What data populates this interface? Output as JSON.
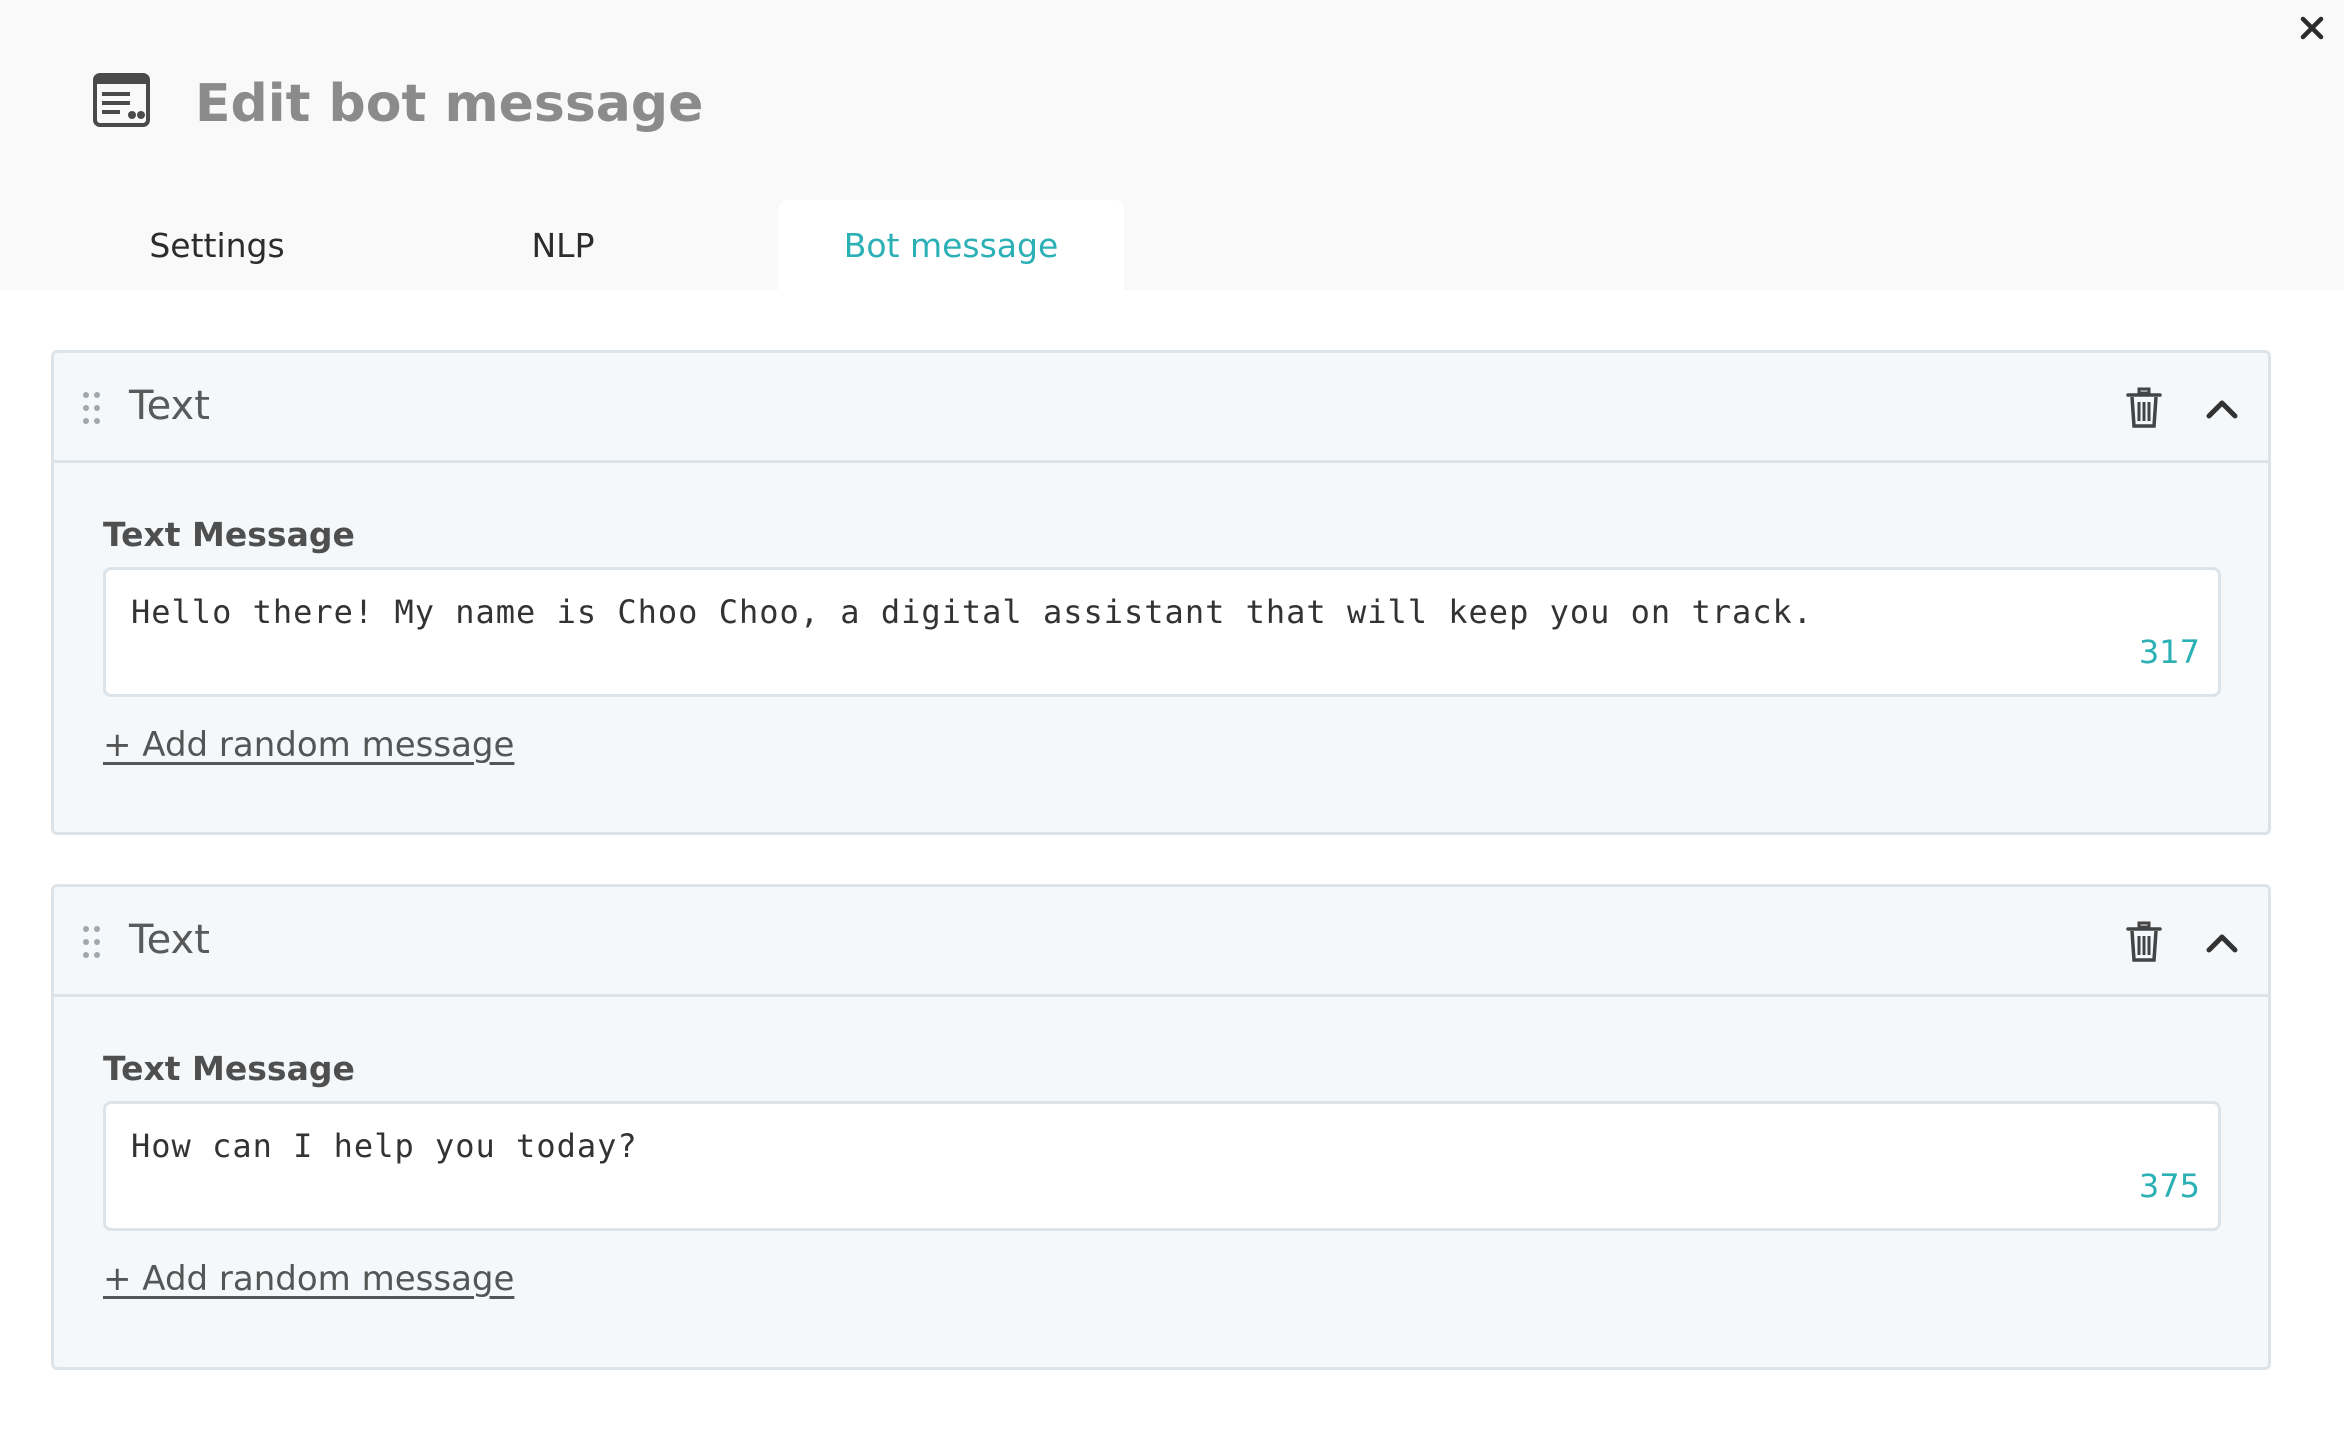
{
  "dialog": {
    "title": "Edit bot message",
    "title_icon": "message-template-icon",
    "close_icon": "close-icon"
  },
  "tabs": [
    {
      "label": "Settings",
      "active": false
    },
    {
      "label": "NLP",
      "active": false
    },
    {
      "label": "Bot message",
      "active": true
    }
  ],
  "colors": {
    "accent": "#2ab0b5",
    "card_bg": "#f5f8fa",
    "border": "#dde4e9",
    "header_bg": "#f9f9f9"
  },
  "cards": [
    {
      "title": "Text",
      "field_label": "Text Message",
      "value": "Hello there! My name is Choo Choo, a digital assistant that will keep you on track.",
      "char_count": "317",
      "add_random_label": "+ Add random message"
    },
    {
      "title": "Text",
      "field_label": "Text Message",
      "value": "How can I help you today?",
      "char_count": "375",
      "add_random_label": "+ Add random message"
    }
  ]
}
